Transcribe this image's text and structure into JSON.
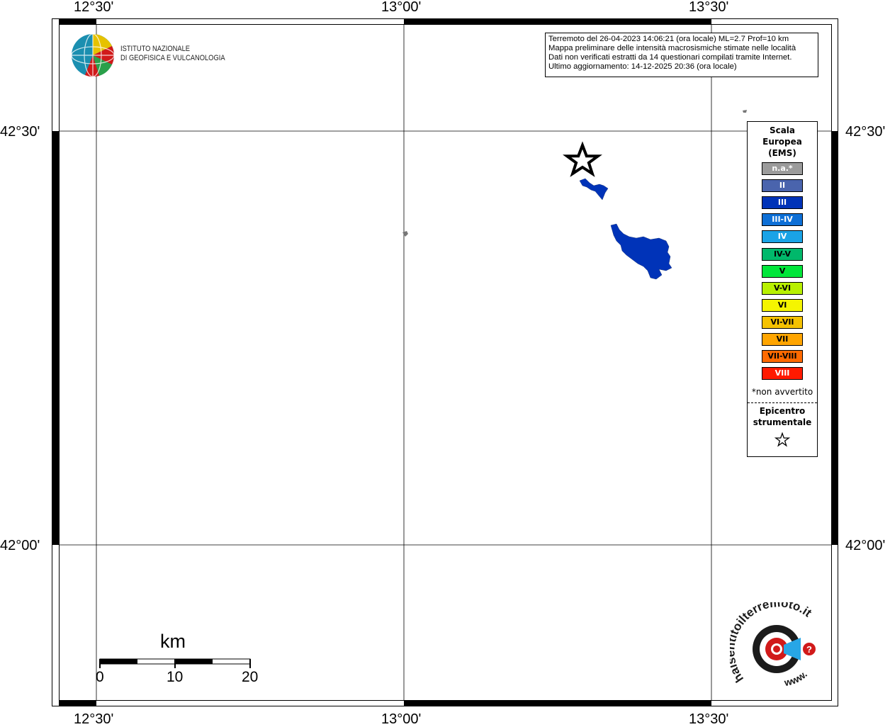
{
  "map": {
    "lon_labels": [
      "12°30'",
      "13°00'",
      "13°30'"
    ],
    "lat_labels": [
      "42°30'",
      "42°00'"
    ]
  },
  "info": {
    "line1": "Terremoto del 26-04-2023 14:06:21 (ora locale) ML=2.7 Prof=10 km",
    "line2": "Mappa preliminare delle intensità macrosismiche stimate nelle località",
    "line3": "Dati non verificati estratti da 14 questionari compilati tramite Internet.",
    "line4": "Ultimo aggiornamento: 14-12-2025 20:36 (ora locale)"
  },
  "logo": {
    "line1": "ISTITUTO NAZIONALE",
    "line2": "DI GEOFISICA E VULCANOLOGIA"
  },
  "legend": {
    "title_lines": [
      "Scala",
      "Europea",
      "(EMS)"
    ],
    "items": [
      {
        "label": "n.a.*",
        "color": "#9b9b9b",
        "text_color": "#ffffff"
      },
      {
        "label": "II",
        "color": "#4a64ad",
        "text_color": "#ffffff"
      },
      {
        "label": "III",
        "color": "#0033b8",
        "text_color": "#ffffff"
      },
      {
        "label": "III-IV",
        "color": "#0d6fd6",
        "text_color": "#ffffff"
      },
      {
        "label": "IV",
        "color": "#1aa3e6",
        "text_color": "#ffffff"
      },
      {
        "label": "IV-V",
        "color": "#00b86b",
        "text_color": "#000000"
      },
      {
        "label": "V",
        "color": "#00e63a",
        "text_color": "#000000"
      },
      {
        "label": "V-VI",
        "color": "#b8f000",
        "text_color": "#000000"
      },
      {
        "label": "VI",
        "color": "#f5f500",
        "text_color": "#000000"
      },
      {
        "label": "VI-VII",
        "color": "#f5c200",
        "text_color": "#000000"
      },
      {
        "label": "VII",
        "color": "#ffa500",
        "text_color": "#000000"
      },
      {
        "label": "VII-VIII",
        "color": "#ff6a00",
        "text_color": "#000000"
      },
      {
        "label": "VIII",
        "color": "#ff1a00",
        "text_color": "#ffffff"
      }
    ],
    "note": "*non avvertito",
    "epicenter_lines": [
      "Epicentro",
      "strumentale"
    ]
  },
  "scale_bar": {
    "unit": "km",
    "ticks": [
      "0",
      "10",
      "20"
    ]
  },
  "hsit_logo": {
    "text": "haisentitoilterremoto.it",
    "url_text": "www."
  }
}
